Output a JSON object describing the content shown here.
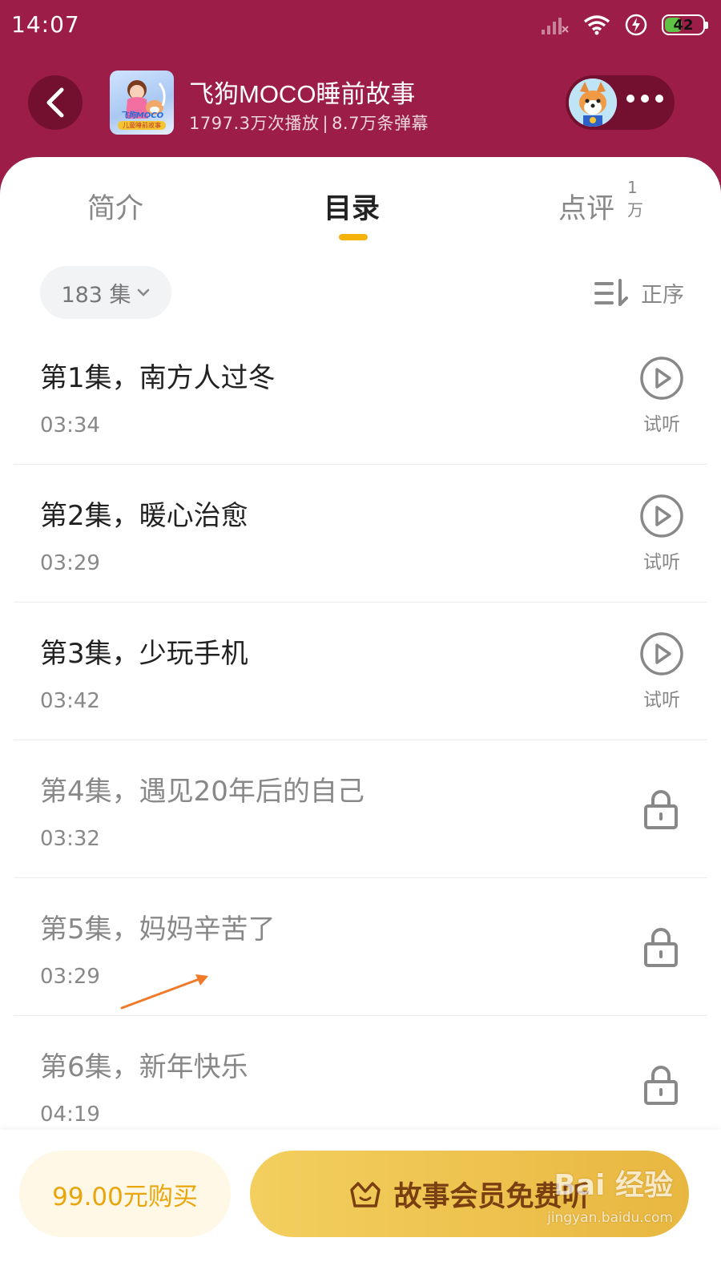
{
  "status_bar": {
    "time": "14:07",
    "battery": "42"
  },
  "header": {
    "title": "飞狗MOCO睡前故事",
    "play_count": "1797.3万次播放",
    "separator": "|",
    "danmaku_count": "8.7万条弹幕",
    "cover_logo_text": "飞狗MOCO",
    "cover_logo_sub": "儿童睡前故事"
  },
  "tabs": {
    "intro": "简介",
    "catalog": "目录",
    "review": "点评",
    "review_badge": "1万"
  },
  "toolbar": {
    "episode_count": "183 集",
    "sort_label": "正序"
  },
  "try_label": "试听",
  "episodes": [
    {
      "title": "第1集，南方人过冬",
      "duration": "03:34",
      "state": "free"
    },
    {
      "title": "第2集，暖心治愈",
      "duration": "03:29",
      "state": "free"
    },
    {
      "title": "第3集，少玩手机",
      "duration": "03:42",
      "state": "free"
    },
    {
      "title": "第4集，遇见20年后的自己",
      "duration": "03:32",
      "state": "locked"
    },
    {
      "title": "第5集，妈妈辛苦了",
      "duration": "03:29",
      "state": "locked"
    },
    {
      "title": "第6集，新年快乐",
      "duration": "04:19",
      "state": "locked"
    }
  ],
  "bottom": {
    "buy_label": "99.00元购买",
    "member_label": "故事会员免费听"
  },
  "watermark": {
    "main": "Bai 经验",
    "sub": "jingyan.baidu.com"
  },
  "colors": {
    "header_bg": "#9c1d47",
    "accent": "#f5b20b",
    "member_gold": "#eac04e",
    "annotation_arrow": "#f07a2a"
  }
}
